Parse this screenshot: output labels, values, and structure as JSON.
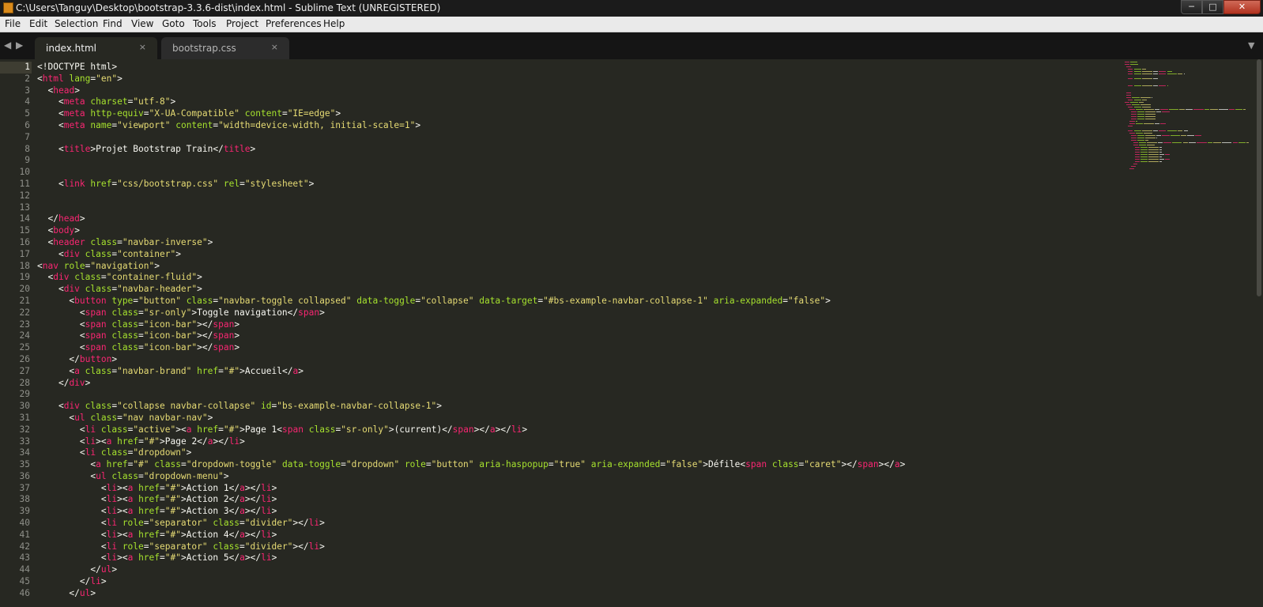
{
  "window": {
    "title": "C:\\Users\\Tanguy\\Desktop\\bootstrap-3.3.6-dist\\index.html - Sublime Text (UNREGISTERED)",
    "minimize": "─",
    "maximize": "□",
    "close": "✕"
  },
  "menu": [
    "File",
    "Edit",
    "Selection",
    "Find",
    "View",
    "Goto",
    "Tools",
    "Project",
    "Preferences",
    "Help"
  ],
  "tabs": [
    {
      "label": "index.html",
      "active": true
    },
    {
      "label": "bootstrap.css",
      "active": false
    }
  ],
  "tab_close_glyph": "×",
  "nav": {
    "back": "◀",
    "forward": "▶",
    "dropdown": "▼"
  },
  "editor": {
    "current_line": 1,
    "colors": {
      "tag": "#f92672",
      "attr": "#a6e22e",
      "string": "#e6db74",
      "text": "#f8f8f2",
      "background": "#272822"
    },
    "lines": [
      "<!DOCTYPE html>",
      "<html lang=\"en\">",
      "  <head>",
      "    <meta charset=\"utf-8\">",
      "    <meta http-equiv=\"X-UA-Compatible\" content=\"IE=edge\">",
      "    <meta name=\"viewport\" content=\"width=device-width, initial-scale=1\">",
      "",
      "    <title>Projet Bootstrap Train</title>",
      "",
      "",
      "    <link href=\"css/bootstrap.css\" rel=\"stylesheet\">",
      "",
      "",
      "  </head>",
      "  <body>",
      "  <header class=\"navbar-inverse\">",
      "    <div class=\"container\">",
      "<nav role=\"navigation\">",
      "  <div class=\"container-fluid\">",
      "    <div class=\"navbar-header\">",
      "      <button type=\"button\" class=\"navbar-toggle collapsed\" data-toggle=\"collapse\" data-target=\"#bs-example-navbar-collapse-1\" aria-expanded=\"false\">",
      "        <span class=\"sr-only\">Toggle navigation</span>",
      "        <span class=\"icon-bar\"></span>",
      "        <span class=\"icon-bar\"></span>",
      "        <span class=\"icon-bar\"></span>",
      "      </button>",
      "      <a class=\"navbar-brand\" href=\"#\">Accueil</a>",
      "    </div>",
      "",
      "    <div class=\"collapse navbar-collapse\" id=\"bs-example-navbar-collapse-1\">",
      "      <ul class=\"nav navbar-nav\">",
      "        <li class=\"active\"><a href=\"#\">Page 1<span class=\"sr-only\">(current)</span></a></li>",
      "        <li><a href=\"#\">Page 2</a></li>",
      "        <li class=\"dropdown\">",
      "          <a href=\"#\" class=\"dropdown-toggle\" data-toggle=\"dropdown\" role=\"button\" aria-haspopup=\"true\" aria-expanded=\"false\">Défile<span class=\"caret\"></span></a>",
      "          <ul class=\"dropdown-menu\">",
      "            <li><a href=\"#\">Action 1</a></li>",
      "            <li><a href=\"#\">Action 2</a></li>",
      "            <li><a href=\"#\">Action 3</a></li>",
      "            <li role=\"separator\" class=\"divider\"></li>",
      "            <li><a href=\"#\">Action 4</a></li>",
      "            <li role=\"separator\" class=\"divider\"></li>",
      "            <li><a href=\"#\">Action 5</a></li>",
      "          </ul>",
      "        </li>",
      "      </ul>"
    ]
  }
}
